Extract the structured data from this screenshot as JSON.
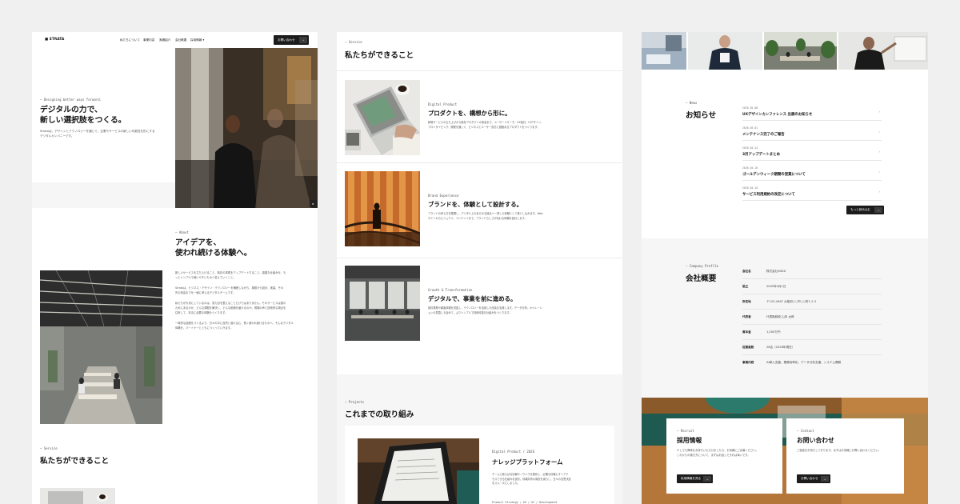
{
  "header": {
    "logo": "■ STRATA",
    "nav": [
      "私たちについて",
      "事業内容",
      "実績紹介",
      "会社概要",
      "採用情報 ▾"
    ],
    "cta_label": "お問い合わせ"
  },
  "hero": {
    "eyebrow": "— Designing better ways forward.",
    "title_line1": "デジタルの力で、",
    "title_line2": "新しい選択肢をつくる。",
    "desc_line1": "Strataは、デザインとテクノロジーを通じて、企業やサービスの新しい可能性を形にする",
    "desc_line2": "デジタルカンパニーです。"
  },
  "about": {
    "eyebrow": "— About",
    "title_line1": "アイデアを、",
    "title_line2": "使われ続ける体験へ。",
    "paragraphs": [
      [
        "新しいサービスを立ち上げること、既存の事業をアップデートすること。複雑な仕組みを、も",
        "っとシンプルで使いやすいものへ変えていくこと。"
      ],
      [
        "Strataは、ビジネス・デザイン・テクノロジーを横断しながら、構想から設計、実装、その",
        "先の改善までを一緒に考えるデジタルチームです。"
      ],
      [
        "私たちが大切にしているのは、見た目を整えることだけではありません。そのサービスは誰の",
        "ためにあるのか、どんな課題を解決し、どんな価値を届けるのか。現場の声と技術的な視点を",
        "往来して、本当に必要な体験をつくります。"
      ],
      [
        "一時的な話題をつくるより、日々の中に自然と溶け込む、長く使われ続けるものへ。そんなデジタル",
        "体験を、パートナーとともにつくっていきます。"
      ]
    ]
  },
  "service_left": {
    "eyebrow": "— Service",
    "title": "私たちができること"
  },
  "services": {
    "eyebrow": "— Service",
    "title": "私たちができること",
    "items": [
      {
        "eyebrow": "Digital Product",
        "title": "プロダクトを、構想から形に。",
        "desc_line1": "新規サービスの立ち上げから既存プロダクトの改善まで、ユーザーリサーチ、UX設計、UIデザイン、",
        "desc_line2": "プロトタイピング、開発を通して、ビジネスとユーザー双方に価値あるプロダクトをつくります。"
      },
      {
        "eyebrow": "Brand Experience",
        "title": "ブランドを、体験として設計する。",
        "desc_line1": "ブランドの考え方を整理し、デジタル上のあらゆる接点へ一貫した体験として落とし込みます。Web",
        "desc_line2": "サイトからビジュアル、コンテンツまで、ブランドらしさが伝わる体験を設計します。"
      },
      {
        "eyebrow": "Growth & Transformation",
        "title": "デジタルで、事業を前に進める。",
        "desc_line1": "既存業務や顧客体験を見直し、テクノロジーを活用した改善を支援します。データ分析、オペレーシ",
        "desc_line2": "ョンの見直しも含めて、よりシンプルで持続可能な仕組みをつくります。"
      }
    ]
  },
  "projects": {
    "eyebrow": "— Projects",
    "title": "これまでの取り組み",
    "card": {
      "tag": "Digital Product / 2026",
      "title": "ナレッジプラットフォーム",
      "desc_line1": "チームに散らばる情報やノウハウを集約し、必要な情報にすぐアク",
      "desc_line2": "セスできる仕組みを設計。情報共有の負担を減らし、日々の意思決定",
      "desc_line3": "をスムーズにしました。",
      "meta": "Product Strategy / UX / UI / Development"
    }
  },
  "news": {
    "eyebrow": "— News",
    "title": "お知らせ",
    "items": [
      {
        "date": "2026.05.08",
        "title": "UXデザインカンファレンス 出展のお知らせ"
      },
      {
        "date": "2026.05.01",
        "title": "メンテナンス完了のご報告"
      },
      {
        "date": "2026.04.24",
        "title": "3月アップデートまとめ"
      },
      {
        "date": "2026.04.18",
        "title": "ゴールデンウィーク期間の営業について"
      },
      {
        "date": "2026.04.10",
        "title": "サービス利用規約の改定について"
      }
    ],
    "more_label": "もっと読み込む"
  },
  "company": {
    "eyebrow": "— Company Profile",
    "title": "会社概要",
    "rows": [
      {
        "label": "会社名",
        "value": "株式会社XXXX"
      },
      {
        "label": "設立",
        "value": "2005年4月1日"
      },
      {
        "label": "所在地",
        "value": "〒123-4567 大阪府○○市○○町1-2-3"
      },
      {
        "label": "代表者",
        "value": "代表取締役 山本 太郎"
      },
      {
        "label": "資本金",
        "value": "1,000万円"
      },
      {
        "label": "従業員数",
        "value": "28名（2026年現在）"
      },
      {
        "label": "事業内容",
        "value": "AI導入支援、業務効率化、データ分析支援、システム開発"
      }
    ]
  },
  "recruit": {
    "eyebrow": "— Recruit",
    "title": "採用情報",
    "desc_line1": "少しでも興味をお持ちいただけましたら、お気軽にご応募ください。",
    "desc_line2": "これからの働き方について、まずはお話しできれば幸いです。",
    "button": "採用情報を見る"
  },
  "contact": {
    "eyebrow": "— Contact",
    "title": "お問い合わせ",
    "desc_line1": "ご相談をお待ちしております。まずはお気軽にお問い合わせください。",
    "button": "お問い合わせ"
  }
}
